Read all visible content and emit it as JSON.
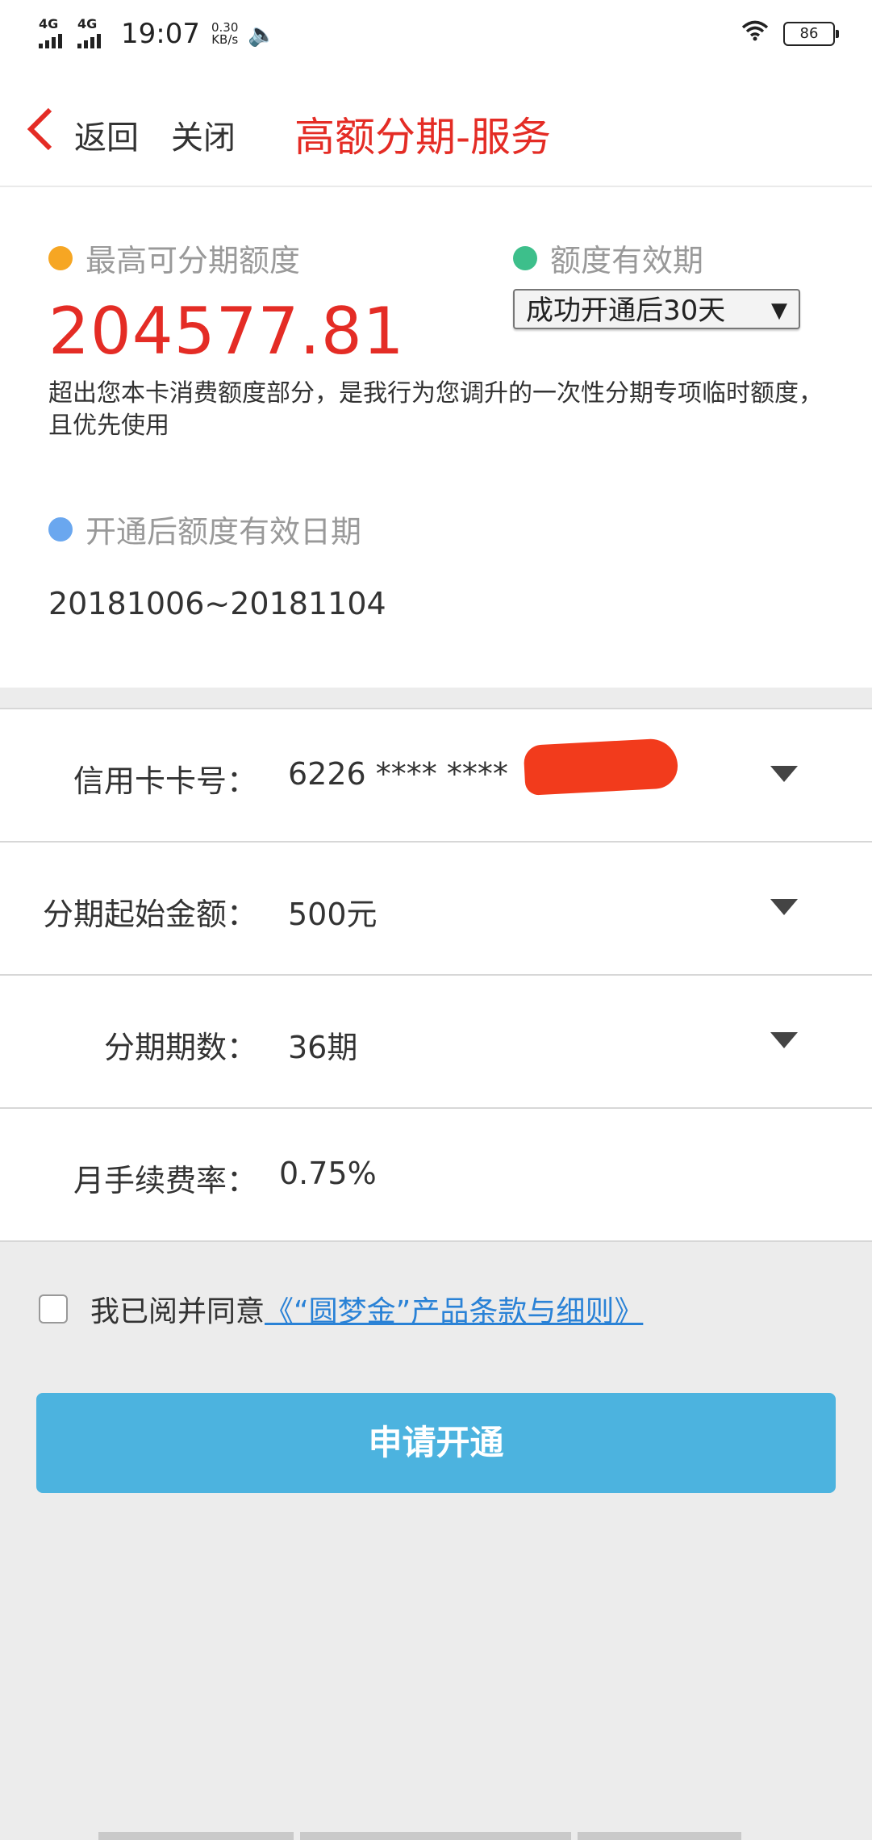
{
  "status_bar": {
    "network1": "4G",
    "network2": "4G",
    "time": "19:07",
    "speed_value": "0.30",
    "speed_unit": "KB/s",
    "battery": "86"
  },
  "nav": {
    "back_label": "返回",
    "close_label": "关闭",
    "title": "高额分期-服务"
  },
  "quota": {
    "max_label": "最高可分期额度",
    "max_amount": "204577.81",
    "validity_label": "额度有效期",
    "validity_selected": "成功开通后30天",
    "description": "超出您本卡消费额度部分，是我行为您调升的一次性分期专项临时额度，且优先使用",
    "date_label": "开通后额度有效日期",
    "date_range": "20181006~20181104",
    "colors": {
      "max_dot": "#f6a623",
      "validity_dot": "#3dbf8b",
      "date_dot": "#6aa7ef"
    }
  },
  "form": {
    "card_label": "信用卡卡号：",
    "card_value": "6226 **** ****",
    "start_amount_label": "分期起始金额：",
    "start_amount_value": "500元",
    "periods_label": "分期期数：",
    "periods_value": "36期",
    "rate_label": "月手续费率：",
    "rate_value": "0.75%"
  },
  "agreement": {
    "text": "我已阅并同意",
    "link": "《“圆梦金”产品条款与细则》"
  },
  "apply_button": "申请开通"
}
